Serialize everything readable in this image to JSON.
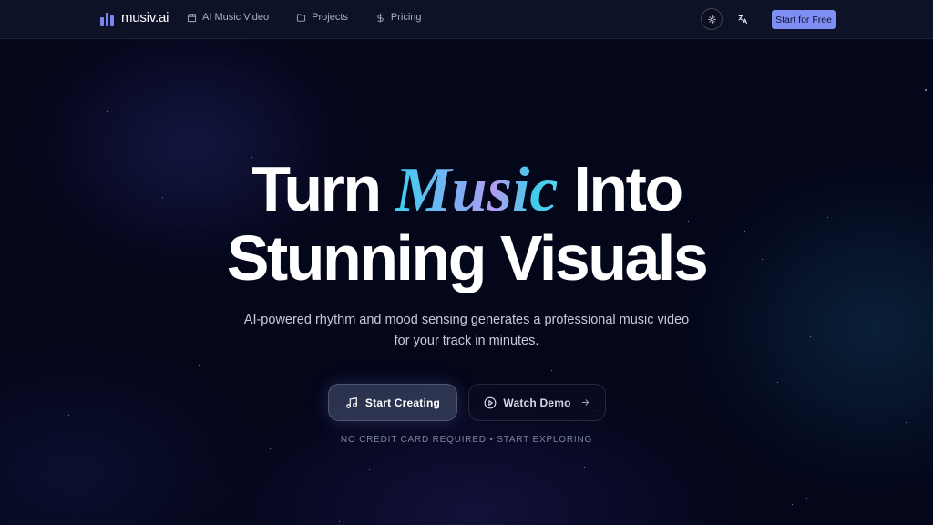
{
  "header": {
    "logo_text": "musiv.ai",
    "nav": [
      {
        "label": "AI Music Video",
        "icon": "clapperboard-icon"
      },
      {
        "label": "Projects",
        "icon": "folder-icon"
      },
      {
        "label": "Pricing",
        "icon": "dollar-icon"
      }
    ],
    "theme_toggle_icon": "sun-icon",
    "language_icon": "translate-icon",
    "cta_label": "Start for Free"
  },
  "hero": {
    "title_pre": "Turn ",
    "title_accent": "Music",
    "title_post": " Into",
    "title_line2": "Stunning Visuals",
    "subtitle": "AI-powered rhythm and mood sensing generates a professional music video for your track in minutes.",
    "primary_button": "Start Creating",
    "secondary_button": "Watch Demo",
    "footnote": "NO CREDIT CARD REQUIRED • START EXPLORING"
  },
  "colors": {
    "background": "#04061a",
    "accent": "#7f8ef3",
    "title_gradient": [
      "#3ed0f0",
      "#8aa8f5",
      "#b69cf0",
      "#3fcbe8"
    ]
  }
}
